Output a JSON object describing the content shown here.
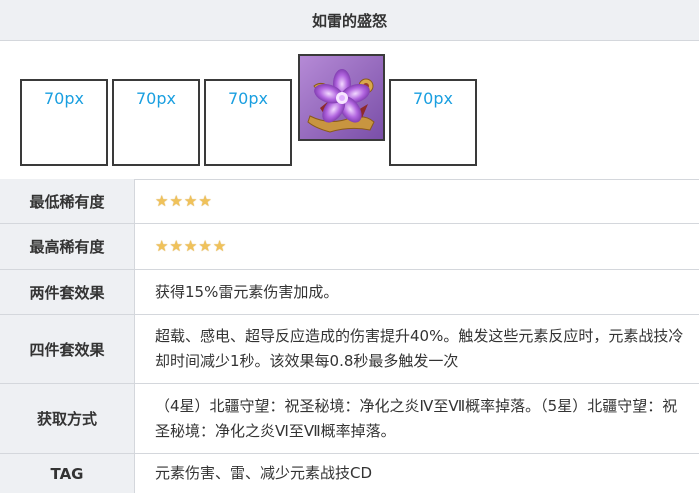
{
  "title": "如雷的盛怒",
  "image_slots": [
    {
      "label": "70px"
    },
    {
      "label": "70px"
    },
    {
      "label": "70px"
    },
    {
      "label": ""
    },
    {
      "label": "70px"
    }
  ],
  "rows": {
    "min_rarity": {
      "label": "最低稀有度",
      "stars": 4
    },
    "max_rarity": {
      "label": "最高稀有度",
      "stars": 5
    },
    "two_piece": {
      "label": "两件套效果",
      "value": "获得15%雷元素伤害加成。"
    },
    "four_piece": {
      "label": "四件套效果",
      "value": "超载、感电、超导反应造成的伤害提升40%。触发这些元素反应时，元素战技冷却时间减少1秒。该效果每0.8秒最多触发一次"
    },
    "obtain": {
      "label": "获取方式",
      "value": "（4星）北疆守望：祝圣秘境：净化之炎Ⅳ至Ⅶ概率掉落。（5星）北疆守望：祝圣秘境：净化之炎Ⅵ至Ⅶ概率掉落。"
    },
    "tag": {
      "label": "TAG",
      "value": "元素伤害、雷、减少元素战技CD"
    }
  },
  "colors": {
    "placeholder_text": "#1a9fe0",
    "header_bg": "#eef0f3",
    "star": "#f0c25a"
  }
}
